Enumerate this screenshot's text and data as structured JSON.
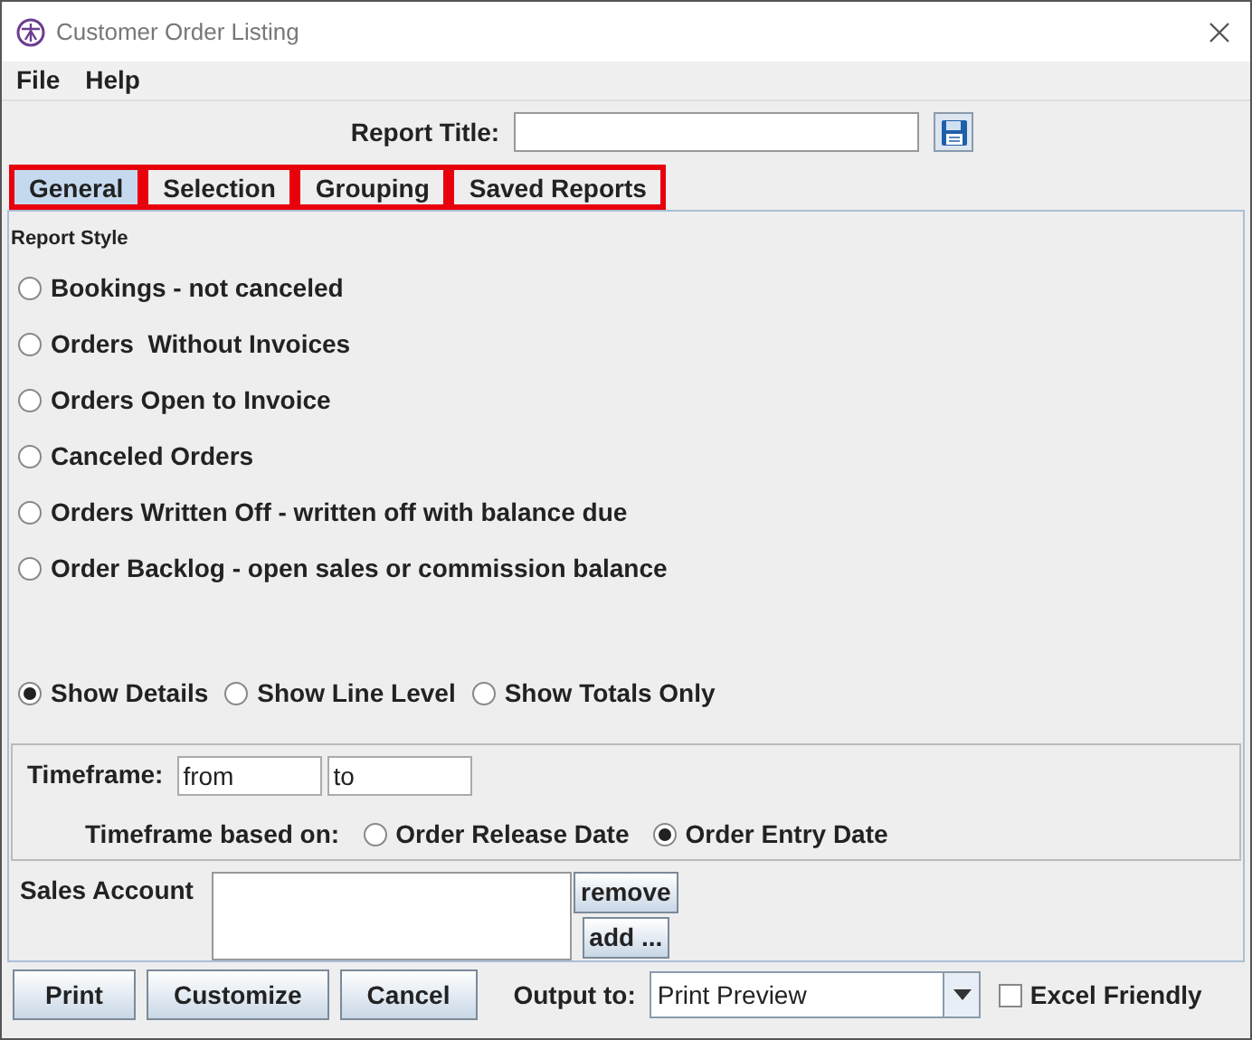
{
  "window": {
    "title": "Customer Order Listing"
  },
  "menu": [
    "File",
    "Help"
  ],
  "report_title": {
    "label": "Report Title:"
  },
  "tabs": [
    {
      "label": "General",
      "selected": true
    },
    {
      "label": "Selection",
      "selected": false
    },
    {
      "label": "Grouping",
      "selected": false
    },
    {
      "label": "Saved Reports",
      "selected": false
    }
  ],
  "report_style": {
    "heading": "Report Style",
    "options": [
      {
        "label": "Bookings - not canceled",
        "selected": false
      },
      {
        "label": "Orders  Without Invoices",
        "selected": false
      },
      {
        "label": "Orders Open to Invoice",
        "selected": false
      },
      {
        "label": "Canceled Orders",
        "selected": false
      },
      {
        "label": "Orders Written Off - written off with balance due",
        "selected": false
      },
      {
        "label": "Order Backlog - open sales or commission balance",
        "selected": false
      }
    ]
  },
  "detail_level": [
    {
      "label": "Show Details",
      "selected": true
    },
    {
      "label": "Show Line Level",
      "selected": false
    },
    {
      "label": "Show Totals Only",
      "selected": false
    }
  ],
  "timeframe": {
    "label": "Timeframe:",
    "from": "from",
    "to": "to",
    "based_on_label": "Timeframe based on:",
    "based_on": [
      {
        "label": "Order Release Date",
        "selected": false
      },
      {
        "label": "Order Entry Date",
        "selected": true
      }
    ]
  },
  "sales_account": {
    "label": "Sales Account",
    "buttons": [
      "remove",
      "add ..."
    ]
  },
  "footer": {
    "buttons": [
      "Print",
      "Customize",
      "Cancel"
    ],
    "output_label": "Output to:",
    "output_value": "Print Preview",
    "excel_friendly": {
      "label": "Excel Friendly",
      "checked": false
    }
  }
}
